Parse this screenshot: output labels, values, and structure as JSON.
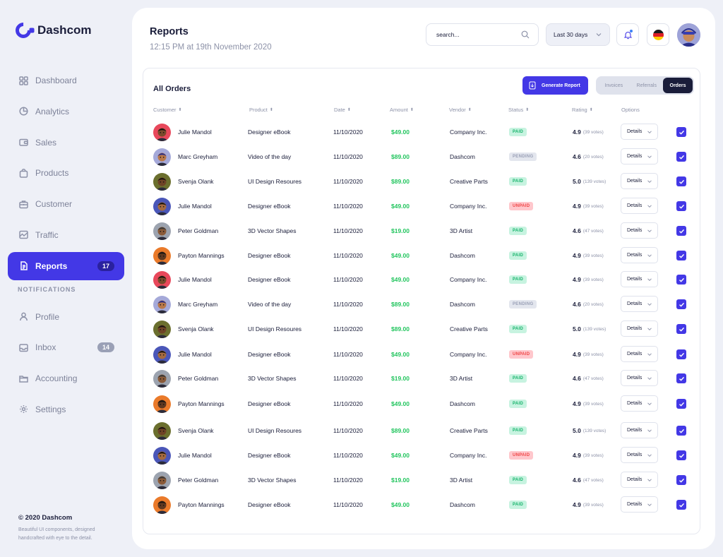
{
  "brand": {
    "name": "Dashcom"
  },
  "colors": {
    "accent": "#4338e6",
    "paid": "#16b36a",
    "unpaid": "#ef4444",
    "pending": "#9aa0b6",
    "amount": "#22c55e"
  },
  "sidebar": {
    "items": [
      {
        "label": "Dashboard",
        "icon": "grid-icon"
      },
      {
        "label": "Analytics",
        "icon": "pie-chart-icon"
      },
      {
        "label": "Sales",
        "icon": "wallet-icon"
      },
      {
        "label": "Products",
        "icon": "bag-icon"
      },
      {
        "label": "Customer",
        "icon": "briefcase-icon"
      },
      {
        "label": "Traffic",
        "icon": "image-chart-icon"
      },
      {
        "label": "Reports",
        "icon": "document-icon",
        "badge": "17",
        "active": true
      }
    ],
    "section_label": "NOTIFICATIONS",
    "items2": [
      {
        "label": "Profile",
        "icon": "user-icon"
      },
      {
        "label": "Inbox",
        "icon": "inbox-icon",
        "badge": "14"
      },
      {
        "label": "Accounting",
        "icon": "folder-icon"
      },
      {
        "label": "Settings",
        "icon": "gear-icon"
      }
    ],
    "footer_title": "© 2020 Dashcom",
    "footer_text": "Beautiful UI components, designed handcrafted with eye to the detail."
  },
  "header": {
    "title": "Reports",
    "subtitle": "12:15 PM at 19th November 2020",
    "search_placeholder": "search...",
    "range_label": "Last 30 days"
  },
  "orders": {
    "title": "All Orders",
    "generate_label": "Generate Report",
    "tabs": [
      "Invoices",
      "Referrals",
      "Orders"
    ],
    "active_tab": "Orders",
    "columns": {
      "customer": "Customer",
      "product": "Product",
      "date": "Date",
      "amount": "Amount",
      "vendor": "Vendor",
      "status": "Status",
      "rating": "Rating",
      "options": "Options"
    },
    "details_label": "Details",
    "rows": [
      {
        "customer": "Julie Mandol",
        "product": "Designer eBook",
        "date": "11/10/2020",
        "amount": "$49.00",
        "vendor": "Company Inc.",
        "status": "PAID",
        "rating": "4.9",
        "votes": "(39 votes)",
        "avatar": "red"
      },
      {
        "customer": "Marc Greyham",
        "product": "Video of the day",
        "date": "11/10/2020",
        "amount": "$89.00",
        "vendor": "Dashcom",
        "status": "PENDING",
        "rating": "4.6",
        "votes": "(20 votes)",
        "avatar": "lilac"
      },
      {
        "customer": "Svenja Olank",
        "product": "UI Design Resoures",
        "date": "11/10/2020",
        "amount": "$89.00",
        "vendor": "Creative Parts",
        "status": "PAID",
        "rating": "5.0",
        "votes": "(139 votes)",
        "avatar": "olive"
      },
      {
        "customer": "Julie Mandol",
        "product": "Designer eBook",
        "date": "11/10/2020",
        "amount": "$49.00",
        "vendor": "Company Inc.",
        "status": "UNPAID",
        "rating": "4.9",
        "votes": "(39 votes)",
        "avatar": "blue"
      },
      {
        "customer": "Peter Goldman",
        "product": "3D Vector Shapes",
        "date": "11/10/2020",
        "amount": "$19.00",
        "vendor": "3D Artist",
        "status": "PAID",
        "rating": "4.6",
        "votes": "(47 votes)",
        "avatar": "grey"
      },
      {
        "customer": "Payton Mannings",
        "product": "Designer eBook",
        "date": "11/10/2020",
        "amount": "$49.00",
        "vendor": "Dashcom",
        "status": "PAID",
        "rating": "4.9",
        "votes": "(39 votes)",
        "avatar": "orange"
      },
      {
        "customer": "Julie Mandol",
        "product": "Designer eBook",
        "date": "11/10/2020",
        "amount": "$49.00",
        "vendor": "Company Inc.",
        "status": "PAID",
        "rating": "4.9",
        "votes": "(39 votes)",
        "avatar": "red"
      },
      {
        "customer": "Marc Greyham",
        "product": "Video of the day",
        "date": "11/10/2020",
        "amount": "$89.00",
        "vendor": "Dashcom",
        "status": "PENDING",
        "rating": "4.6",
        "votes": "(20 votes)",
        "avatar": "lilac"
      },
      {
        "customer": "Svenja Olank",
        "product": "UI Design Resoures",
        "date": "11/10/2020",
        "amount": "$89.00",
        "vendor": "Creative Parts",
        "status": "PAID",
        "rating": "5.0",
        "votes": "(139 votes)",
        "avatar": "olive"
      },
      {
        "customer": "Julie Mandol",
        "product": "Designer eBook",
        "date": "11/10/2020",
        "amount": "$49.00",
        "vendor": "Company Inc.",
        "status": "UNPAID",
        "rating": "4.9",
        "votes": "(39 votes)",
        "avatar": "blue"
      },
      {
        "customer": "Peter Goldman",
        "product": "3D Vector Shapes",
        "date": "11/10/2020",
        "amount": "$19.00",
        "vendor": "3D Artist",
        "status": "PAID",
        "rating": "4.6",
        "votes": "(47 votes)",
        "avatar": "grey"
      },
      {
        "customer": "Payton Mannings",
        "product": "Designer eBook",
        "date": "11/10/2020",
        "amount": "$49.00",
        "vendor": "Dashcom",
        "status": "PAID",
        "rating": "4.9",
        "votes": "(39 votes)",
        "avatar": "orange"
      },
      {
        "customer": "Svenja Olank",
        "product": "UI Design Resoures",
        "date": "11/10/2020",
        "amount": "$89.00",
        "vendor": "Creative Parts",
        "status": "PAID",
        "rating": "5.0",
        "votes": "(139 votes)",
        "avatar": "olive"
      },
      {
        "customer": "Julie Mandol",
        "product": "Designer eBook",
        "date": "11/10/2020",
        "amount": "$49.00",
        "vendor": "Company Inc.",
        "status": "UNPAID",
        "rating": "4.9",
        "votes": "(39 votes)",
        "avatar": "blue"
      },
      {
        "customer": "Peter Goldman",
        "product": "3D Vector Shapes",
        "date": "11/10/2020",
        "amount": "$19.00",
        "vendor": "3D Artist",
        "status": "PAID",
        "rating": "4.6",
        "votes": "(47 votes)",
        "avatar": "grey"
      },
      {
        "customer": "Payton Mannings",
        "product": "Designer eBook",
        "date": "11/10/2020",
        "amount": "$49.00",
        "vendor": "Dashcom",
        "status": "PAID",
        "rating": "4.9",
        "votes": "(39 votes)",
        "avatar": "orange"
      }
    ]
  }
}
